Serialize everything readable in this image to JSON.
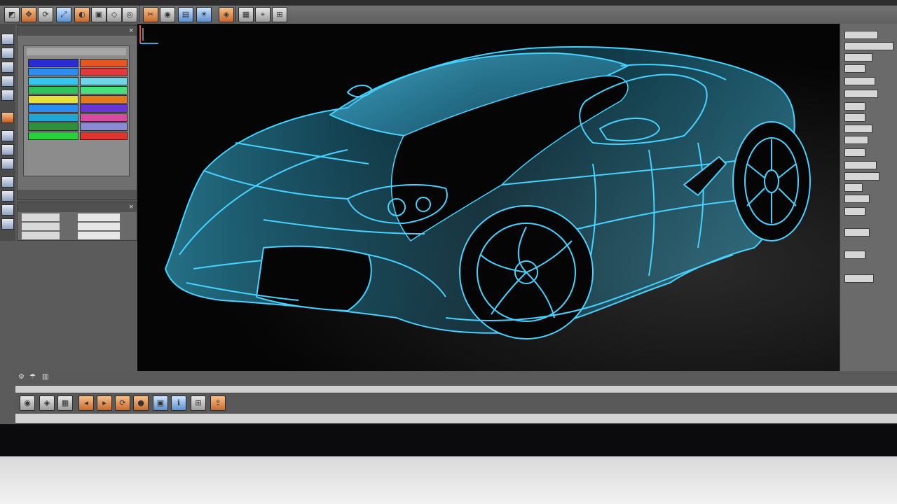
{
  "app": {
    "accent_color": "#35c6f0",
    "viewport_background": "#050505"
  },
  "top_toolbar": {
    "buttons": [
      "select-icon",
      "move-icon",
      "rotate-icon",
      "scale-icon",
      "mirror-icon",
      "extrude-icon",
      "bevel-icon",
      "loop-icon",
      "cut-icon",
      "render-icon",
      "camera-icon",
      "light-icon",
      "material-icon",
      "texture-icon",
      "snap-icon",
      "grid-icon",
      "undo-icon",
      "redo-icon"
    ]
  },
  "layers_panel": {
    "rows": [
      {
        "color_left": "#2b2bd6",
        "color_right": "#e8561f"
      },
      {
        "color_left": "#2e8ef0",
        "color_right": "#e23a3a"
      },
      {
        "color_left": "#35c6f0",
        "color_right": "#6fd6e8"
      },
      {
        "color_left": "#2ec25a",
        "color_right": "#48e07a"
      },
      {
        "color_left": "#e6e13a",
        "color_right": "#e37a1a"
      },
      {
        "color_left": "#2a8ef0",
        "color_right": "#6a35d6"
      },
      {
        "color_left": "#1fa8d6",
        "color_right": "#d64aa0"
      },
      {
        "color_left": "#2f8f3a",
        "color_right": "#8a8ad6"
      },
      {
        "color_left": "#27d13a",
        "color_right": "#e0352e"
      }
    ]
  },
  "right_panel": {
    "fields": 19
  },
  "bottom_toolbar": {
    "buttons": [
      "play-icon",
      "keyframe-icon",
      "key-filter-icon",
      "frame-back-icon",
      "frame-forward-icon",
      "loop-play-icon",
      "record-icon",
      "snapshot-icon",
      "info-icon",
      "timeline-icon",
      "graph-icon",
      "export-icon"
    ]
  }
}
